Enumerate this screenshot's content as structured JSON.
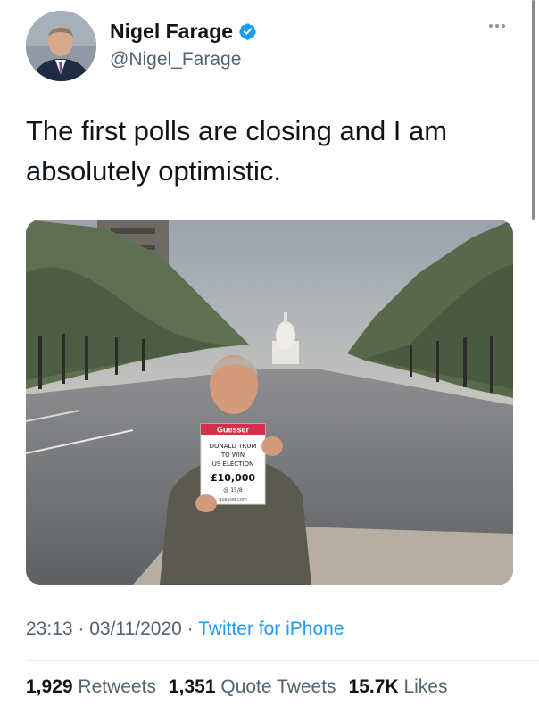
{
  "author": {
    "name": "Nigel Farage",
    "handle": "@Nigel_Farage",
    "verified_icon": "verified-badge-icon"
  },
  "tweet": {
    "text_line1": "The first polls are closing and I am",
    "text_line2": "absolutely optimistic."
  },
  "media": {
    "sign": {
      "brand": "Guesser",
      "line1": "DONALD TRUM",
      "line2": "TO WIN",
      "line3": "US ELECTION",
      "amount": "£10,000",
      "odds": "@ 15/8",
      "site": "guesser.com"
    }
  },
  "meta": {
    "time": "23:13",
    "date": "03/11/2020",
    "separator": "·",
    "source": "Twitter for iPhone"
  },
  "stats": {
    "retweets_count": "1,929",
    "retweets_label": "Retweets",
    "quotes_count": "1,351",
    "quotes_label": "Quote Tweets",
    "likes_count": "15.7K",
    "likes_label": "Likes"
  },
  "colors": {
    "link": "#1d9bf0",
    "secondary_text": "#536471",
    "primary_text": "#0f1419"
  }
}
